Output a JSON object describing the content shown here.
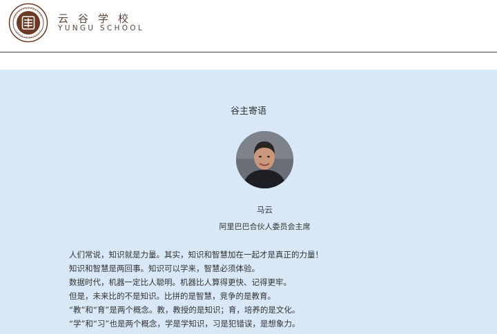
{
  "header": {
    "brand_cn": "云谷学校",
    "brand_en": "YUNGU SCHOOL",
    "logo_icon": "yungu-school-seal-icon",
    "brand_color": "#6b3a24"
  },
  "main": {
    "section_title": "谷主寄语",
    "person": {
      "name": "马云",
      "title": "阿里巴巴合伙人委员会主席"
    },
    "paragraphs": [
      "人们常说，知识就是力量。其实，知识和智慧加在一起才是真正的力量！",
      "知识和智慧是两回事。知识可以学来，智慧必须体验。",
      "数据时代，机器一定比人聪明。机器比人算得更快、记得更牢。",
      "但是，未来比的不是知识。比拼的是智慧，竞争的是教育。",
      "“教”和“育”是两个概念。教，教授的是知识；育，培养的是文化。",
      "“学”和“习”也是两个概念，学是学知识，习是犯错误，是想象力。"
    ],
    "background_color": "#d9e8f6"
  }
}
